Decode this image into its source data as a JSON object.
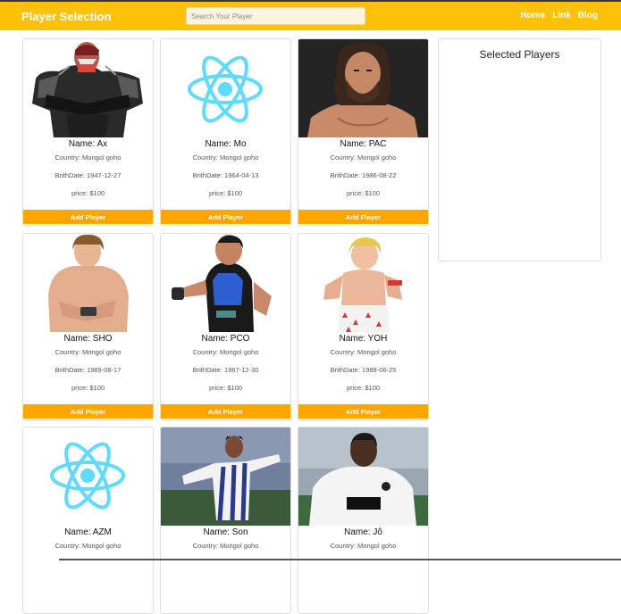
{
  "navbar": {
    "brand": "Player Selection",
    "search_placeholder": "Search Your Player",
    "links": [
      "Home",
      "Link",
      "Blog"
    ]
  },
  "selected_panel": {
    "title": "Selected Players"
  },
  "players": [
    {
      "name": "Name: Ax",
      "country": "Country: Mongol goho",
      "birthdate": "BrithDate: 1947-12-27",
      "price": "price: $100",
      "button": "Add Player",
      "image": "wrestler-photo"
    },
    {
      "name": "Name: Mo",
      "country": "Country: Mongol goho",
      "birthdate": "BrithDate: 1964-04-13",
      "price": "price: $100",
      "button": "Add Player",
      "image": "react-logo"
    },
    {
      "name": "Name: PAC",
      "country": "Country: Mongol goho",
      "birthdate": "BrithDate: 1986-08-22",
      "price": "price: $100",
      "button": "Add Player",
      "image": "wrestler-photo"
    },
    {
      "name": "Name: SHO",
      "country": "Country: Mongol goho",
      "birthdate": "BrithDate: 1989-08-17",
      "price": "price: $100",
      "button": "Add Player",
      "image": "wrestler-photo"
    },
    {
      "name": "Name: PCO",
      "country": "Country: Mongol goho",
      "birthdate": "BrithDate: 1967-12-30",
      "price": "price: $100",
      "button": "Add Player",
      "image": "wrestler-photo"
    },
    {
      "name": "Name: YOH",
      "country": "Country: Mongol goho",
      "birthdate": "BrithDate: 1988-06-25",
      "price": "price: $100",
      "button": "Add Player",
      "image": "wrestler-photo"
    },
    {
      "name": "Name: AZM",
      "country": "Country: Mongol goho",
      "image": "react-logo"
    },
    {
      "name": "Name: Son",
      "country": "Country: Mongol goho",
      "image": "footballer-photo"
    },
    {
      "name": "Name: Jô",
      "country": "Country: Mongol goho",
      "image": "footballer-photo"
    }
  ],
  "colors": {
    "navbar": "#ffc107",
    "button": "#ffa500",
    "react_logo": "#61dafb"
  }
}
